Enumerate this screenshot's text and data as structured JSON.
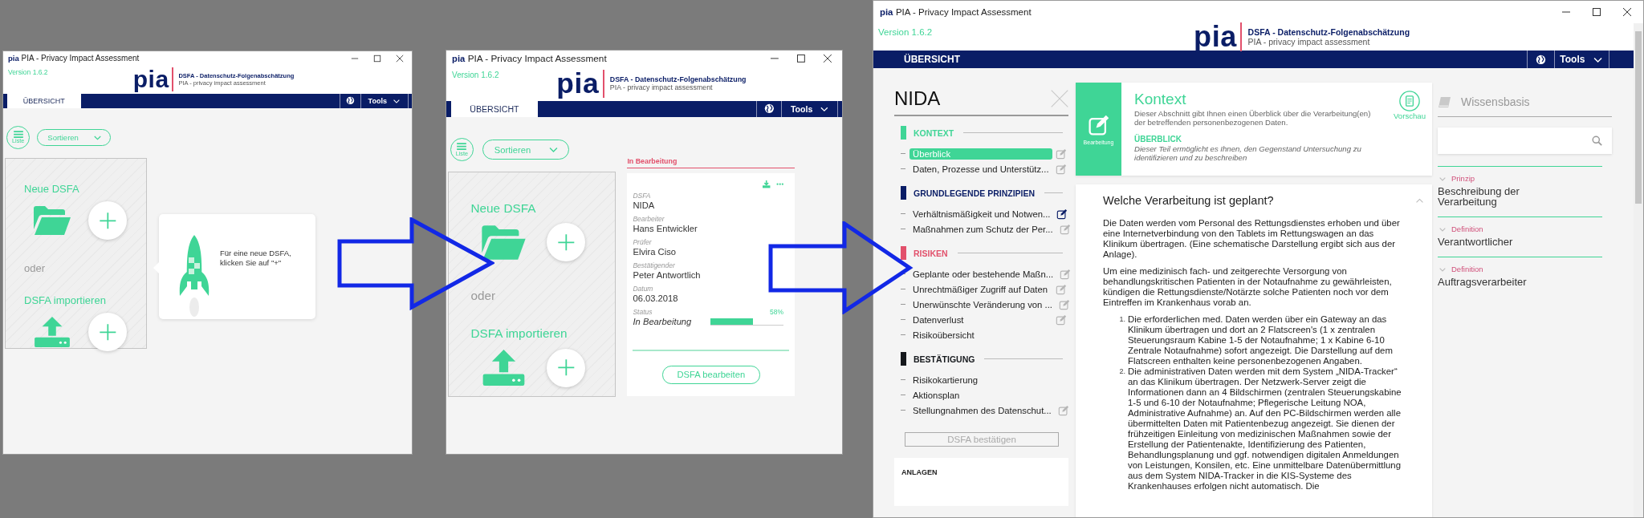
{
  "windows": [
    {
      "kind": "overview",
      "app_icon_text": "pia",
      "title": "PIA - Privacy Impact Assessment",
      "version": "Version 1.6.2",
      "logo": "pia",
      "header_title": "DSFA - Datenschutz-Folgenabschätzung",
      "header_subtitle": "PIA - privacy impact assessment",
      "tabs": [
        {
          "label": "ÜBERSICHT",
          "selected": true
        }
      ],
      "tools_label": "Tools",
      "list_toggle": "Liste",
      "sort_label": "Sortieren",
      "new_card": {
        "new_label": "Neue DSFA",
        "or_label": "oder",
        "import_label": "DSFA importieren"
      },
      "tooltip": "Für eine neue DSFA, klicken Sie auf \"+\""
    },
    {
      "kind": "overview",
      "app_icon_text": "pia",
      "title": "PIA - Privacy Impact Assessment",
      "version": "Version 1.6.2",
      "logo": "pia",
      "header_title": "DSFA - Datenschutz-Folgenabschätzung",
      "header_subtitle": "PIA - privacy impact assessment",
      "tabs": [
        {
          "label": "ÜBERSICHT",
          "selected": true
        }
      ],
      "tools_label": "Tools",
      "list_toggle": "Liste",
      "sort_label": "Sortieren",
      "new_card": {
        "new_label": "Neue DSFA",
        "or_label": "oder",
        "import_label": "DSFA importieren"
      },
      "in_progress": {
        "heading": "In Bearbeitung",
        "fields": [
          {
            "label": "DSFA",
            "value": "NIDA"
          },
          {
            "label": "Bearbeiter",
            "value": "Hans Entwickler"
          },
          {
            "label": "Prüfer",
            "value": "Elvira Ciso"
          },
          {
            "label": "Bestätigender",
            "value": "Peter Antwortlich"
          },
          {
            "label": "Datum",
            "value": "06.03.2018"
          }
        ],
        "status": {
          "label": "Status",
          "value": "In Bearbeitung",
          "reading": "58%",
          "level": 0.58
        },
        "action": "DSFA bearbeiten"
      }
    },
    {
      "kind": "editor",
      "app_icon_text": "pia",
      "title": "PIA - Privacy Impact Assessment",
      "version": "Version 1.6.2",
      "logo": "pia",
      "header_title": "DSFA - Datenschutz-Folgenabschätzung",
      "header_subtitle": "PIA - privacy impact assessment",
      "tabs": [
        {
          "label": "ÜBERSICHT",
          "selected": false
        }
      ],
      "tools_label": "Tools",
      "sidebar": {
        "title": "NIDA",
        "sections": [
          {
            "label": "KONTEXT",
            "color": "#3fd596",
            "items": [
              {
                "label": "Überblick",
                "selected": true,
                "editable": true,
                "edit_active": false
              },
              {
                "label": "Daten, Prozesse und Unterstütz...",
                "selected": false,
                "editable": true,
                "edit_active": false
              }
            ]
          },
          {
            "label": "GRUNDLEGENDE PRINZIPIEN",
            "color": "#0a1d66",
            "items": [
              {
                "label": "Verhältnismäßigkeit und Notwen...",
                "selected": false,
                "editable": true,
                "edit_active": true
              },
              {
                "label": "Maßnahmen zum Schutz der Per...",
                "selected": false,
                "editable": true,
                "edit_active": false
              }
            ]
          },
          {
            "label": "RISIKEN",
            "color": "#e2506b",
            "items": [
              {
                "label": "Geplante oder bestehende Maßn...",
                "selected": false,
                "editable": true,
                "edit_active": false
              },
              {
                "label": "Unrechtmäßiger Zugriff auf Daten",
                "selected": false,
                "editable": true,
                "edit_active": false
              },
              {
                "label": "Unerwünschte Veränderung von ...",
                "selected": false,
                "editable": true,
                "edit_active": false
              },
              {
                "label": "Datenverlust",
                "selected": false,
                "editable": true,
                "edit_active": false
              },
              {
                "label": "Risikoübersicht",
                "selected": false,
                "editable": false
              }
            ]
          },
          {
            "label": "BESTÄTIGUNG",
            "color": "#15181c",
            "items": [
              {
                "label": "Risikokartierung",
                "selected": false,
                "editable": false
              },
              {
                "label": "Aktionsplan",
                "selected": false,
                "editable": false
              },
              {
                "label": "Stellungnahmen des Datenschut...",
                "selected": false,
                "editable": true,
                "edit_active": false
              }
            ]
          }
        ],
        "confirm_button": {
          "label": "DSFA bestätigen",
          "disabled": true
        },
        "attachments_heading": "ANLAGEN"
      },
      "section_header": {
        "action_label": "Bearbeitung",
        "title": "Kontext",
        "description": "Dieser Abschnitt gibt Ihnen einen Überblick über die Verarbeitung(en) der betreffenden personenbezogenen Daten.",
        "subheading": "ÜBERBLICK",
        "subdescription": "Dieser Teil ermöglicht es Ihnen, den Gegenstand Untersuchung zu identifizieren und zu beschreiben",
        "preview_label": "Vorschau"
      },
      "question": {
        "title": "Welche Verarbeitung ist geplant?",
        "expanded": true,
        "paragraphs": [
          "Die Daten werden vom Personal des Rettungsdienstes erhoben und über eine Internetverbindung von den Tablets im Rettungswagen an das Klinikum übertragen. (Eine schematische Darstellung ergibt sich aus der Anlage).",
          "Um eine medizinisch fach- und zeitgerechte Versorgung von behandlungskritischen Patienten in der Notaufnahme zu gewährleisten, kündigen die Rettungsdienste/Notärzte solche Patienten noch vor dem Eintreffen im Krankenhaus vorab an."
        ],
        "list": [
          {
            "number": "1.",
            "text": "Die erforderlichen med. Daten werden über ein Gateway an das Klinikum übertragen und dort an 2 Flatscreen's (1 x zentralen Steuerungsraum Kabine 1-5 der Notaufnahme; 1 x Kabine 6-10 Zentrale Notaufnahme) sofort angezeigt. Die Darstellung auf dem Flatscreen enthalten keine personenbezogenen Angaben."
          },
          {
            "number": "2.",
            "text": "Die administrativen Daten werden mit dem System „NIDA-Tracker“ an das Klinikum übertragen. Der Netzwerk-Server zeigt die Informationen dann an 4 Bildschirmen (zentralen Steuerungskabine 1-5 und 6-10 der Notaufnahme; Pflegerische Leitung NOA, Administrative Aufnahme) an. Auf den PC-Bildschirmen werden alle übermittelten Daten mit Patientenbezug angezeigt. Sie dienen der frühzeitigen Einleitung von medizinischen Maßnahmen sowie der Erstellung der Patientenakte, Identifizierung des Patienten, Behandlungsplanung und ggf. notwendigen digitalen Anmeldungen von Leistungen, Konsilen, etc. Eine unmittelbare Datenübermittlung aus dem System NIDA-Tracker in die KIS-Systeme des Krankenhauses erfolgen nicht automatisch. Die"
          }
        ]
      },
      "knowledge_base": {
        "title": "Wissensbasis",
        "entries": [
          {
            "category": "Prinzip",
            "title": "Beschreibung der Verarbeitung"
          },
          {
            "category": "Definition",
            "title": "Verantwortlicher"
          },
          {
            "category": "Definition",
            "title": "Auftragsverarbeiter"
          }
        ]
      }
    }
  ]
}
